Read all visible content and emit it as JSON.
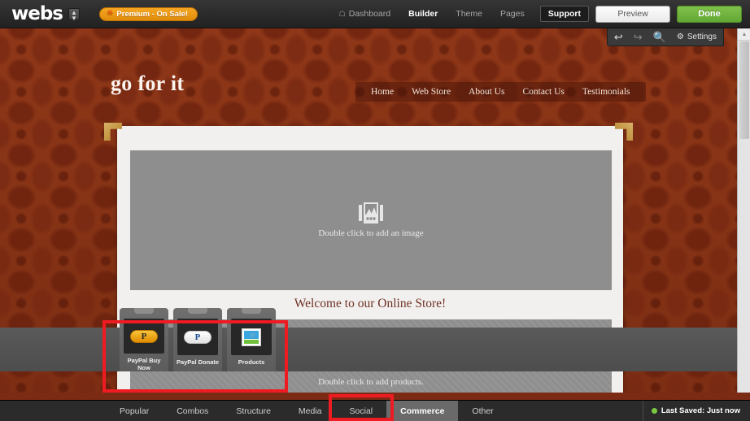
{
  "topbar": {
    "logo": "webs",
    "logo_caret_icon": "updown-caret-icon",
    "premium": {
      "label": "Premium - On Sale!",
      "star_icon": "star-icon",
      "color": "#e89a1c"
    },
    "nav": [
      {
        "label": "Dashboard",
        "icon": "home-icon",
        "active": false
      },
      {
        "label": "Builder",
        "active": true
      },
      {
        "label": "Theme",
        "active": false
      },
      {
        "label": "Pages",
        "active": false
      }
    ],
    "support_label": "Support",
    "preview_label": "Preview",
    "done_label": "Done",
    "done_color": "#6fb13e"
  },
  "site_toolbar": {
    "undo_icon": "undo-arrow-icon",
    "redo_icon": "redo-arrow-icon",
    "zoom_icon": "magnifier-icon",
    "settings_icon": "gear-icon",
    "settings_label": "Settings"
  },
  "site": {
    "title": "go for it",
    "nav": [
      {
        "label": "Home"
      },
      {
        "label": "Web Store"
      },
      {
        "label": "About Us"
      },
      {
        "label": "Contact Us"
      },
      {
        "label": "Testimonials"
      }
    ],
    "image_placeholder": {
      "icon": "picture-frame-icon",
      "label": "Double click to add an image"
    },
    "heading": "Welcome to our Online Store!",
    "products_placeholder": {
      "icon": "price-tag-icon",
      "label": "Double click to add products."
    }
  },
  "palette": {
    "widgets": [
      {
        "name": "PayPal Buy Now",
        "icon": "paypal-buy-now-icon",
        "glyph": "P",
        "style": "buy"
      },
      {
        "name": "PayPal Donate",
        "icon": "paypal-donate-icon",
        "glyph": "P",
        "style": "donate"
      },
      {
        "name": "Products",
        "icon": "products-store-icon",
        "glyph": "",
        "style": "products"
      }
    ],
    "highlight_color": "#ee1c22"
  },
  "tabbar": {
    "tabs": [
      {
        "label": "Popular",
        "active": false
      },
      {
        "label": "Combos",
        "active": false
      },
      {
        "label": "Structure",
        "active": false
      },
      {
        "label": "Media",
        "active": false
      },
      {
        "label": "Social",
        "active": false
      },
      {
        "label": "Commerce",
        "active": true
      },
      {
        "label": "Other",
        "active": false
      }
    ],
    "saved_status": "Last Saved: Just now",
    "saved_dot_color": "#7ac943"
  },
  "scrollbar": {
    "up_arrow_icon": "scroll-up-arrow-icon"
  }
}
